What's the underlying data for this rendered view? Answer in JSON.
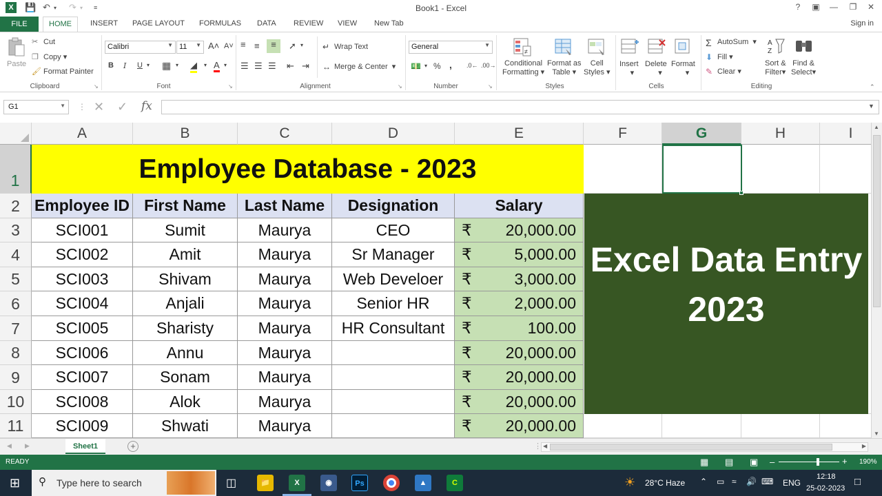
{
  "titlebar": {
    "title": "Book1 - Excel",
    "help": "?",
    "signin": "Sign in"
  },
  "tabs": [
    "FILE",
    "HOME",
    "INSERT",
    "PAGE LAYOUT",
    "FORMULAS",
    "DATA",
    "REVIEW",
    "VIEW",
    "New Tab"
  ],
  "ribbon": {
    "clipboard": {
      "paste": "Paste",
      "cut": "Cut",
      "copy": "Copy",
      "format_painter": "Format Painter",
      "label": "Clipboard"
    },
    "font": {
      "name": "Calibri",
      "size": "11",
      "label": "Font",
      "bold": "B",
      "italic": "I",
      "underline": "U"
    },
    "alignment": {
      "wrap": "Wrap Text",
      "merge": "Merge & Center",
      "label": "Alignment"
    },
    "number": {
      "format": "General",
      "percent": "%",
      "comma": ",",
      "label": "Number"
    },
    "styles": {
      "conditional": "Conditional",
      "conditional2": "Formatting",
      "format_table": "Format as",
      "format_table2": "Table",
      "cell_styles": "Cell",
      "cell_styles2": "Styles",
      "label": "Styles"
    },
    "cells": {
      "insert": "Insert",
      "delete": "Delete",
      "format": "Format",
      "label": "Cells"
    },
    "editing": {
      "autosum": "AutoSum",
      "fill": "Fill",
      "clear": "Clear",
      "sort": "Sort &",
      "sort2": "Filter",
      "find": "Find &",
      "find2": "Select",
      "label": "Editing"
    }
  },
  "formula_bar": {
    "name_box": "G1",
    "fx": "fx",
    "value": ""
  },
  "columns": [
    "A",
    "B",
    "C",
    "D",
    "E",
    "F",
    "G",
    "H",
    "I"
  ],
  "rows": [
    "1",
    "2",
    "3",
    "4",
    "5",
    "6",
    "7",
    "8",
    "9",
    "10",
    "11"
  ],
  "sheet": {
    "title": "Employee Database - 2023",
    "headers": [
      "Employee ID",
      "First Name",
      "Last Name",
      "Designation",
      "Salary"
    ],
    "currency_symbol": "₹",
    "records": [
      [
        "SCI001",
        "Sumit",
        "Maurya",
        "CEO",
        "20,000.00"
      ],
      [
        "SCI002",
        "Amit",
        "Maurya",
        "Sr Manager",
        "5,000.00"
      ],
      [
        "SCI003",
        "Shivam",
        "Maurya",
        "Web Develoer",
        "3,000.00"
      ],
      [
        "SCI004",
        "Anjali",
        "Maurya",
        "Senior HR",
        "2,000.00"
      ],
      [
        "SCI005",
        "Sharisty",
        "Maurya",
        "HR Consultant",
        "100.00"
      ],
      [
        "SCI006",
        "Annu",
        "Maurya",
        "",
        "20,000.00"
      ],
      [
        "SCI007",
        "Sonam",
        "Maurya",
        "",
        "20,000.00"
      ],
      [
        "SCI008",
        "Alok",
        "Maurya",
        "",
        "20,000.00"
      ],
      [
        "SCI009",
        "Shwati",
        "Maurya",
        "",
        "20,000.00"
      ]
    ],
    "banner_line1": "Excel Data Entry",
    "banner_line2": "2023"
  },
  "sheet_tabs": [
    "Sheet1"
  ],
  "statusbar": {
    "status": "READY",
    "zoom": "190%"
  },
  "taskbar": {
    "search_placeholder": "Type here to search",
    "weather": "28°C  Haze",
    "lang": "ENG",
    "time": "12:18",
    "date": "25-02-2023"
  },
  "colors": {
    "excel_green": "#217346",
    "banner_yellow": "#ffff00",
    "panel_green": "#375623",
    "header_blue": "#dce1f2",
    "salary_green": "#c6e0b4"
  }
}
